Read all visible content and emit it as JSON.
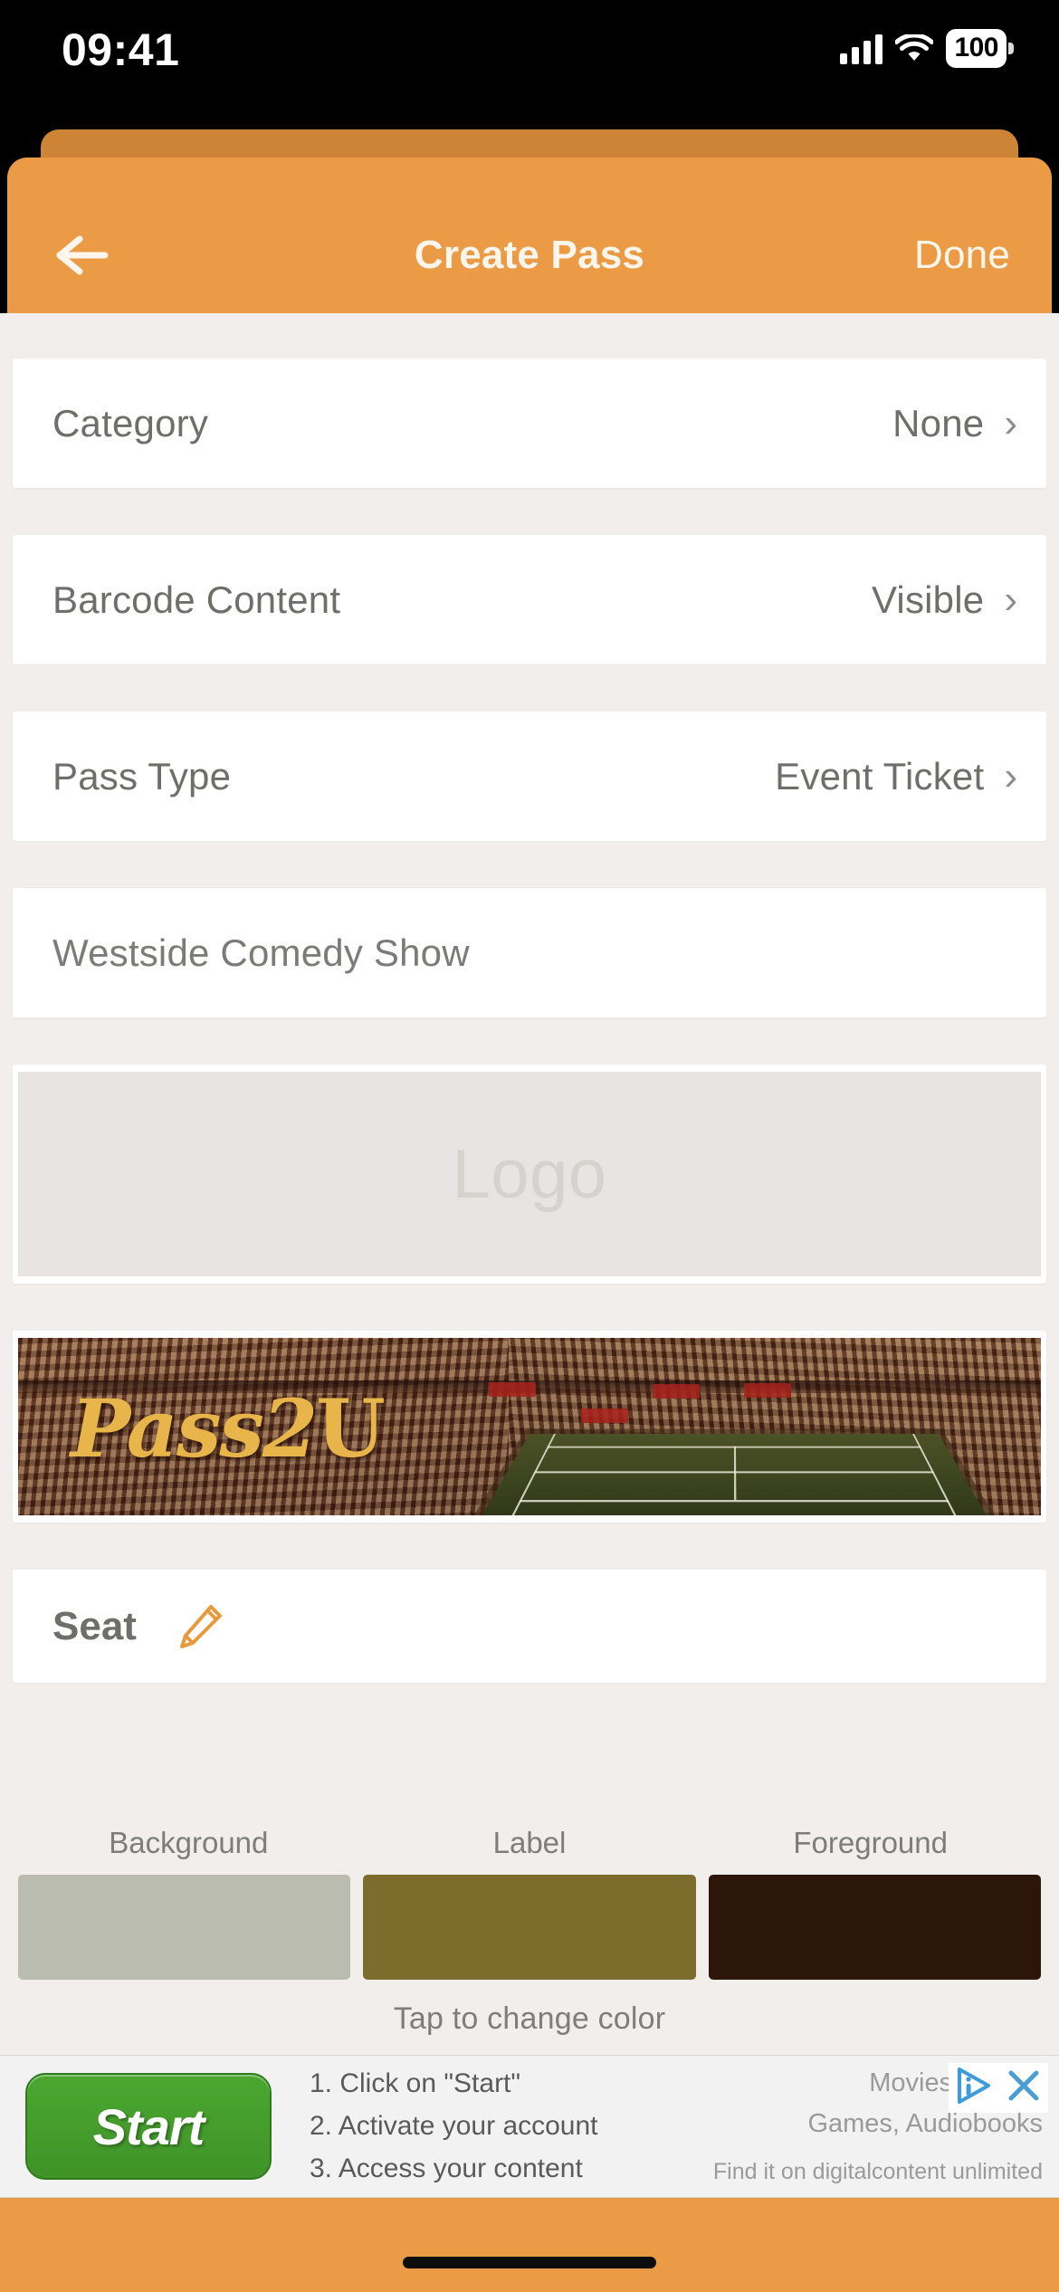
{
  "status_bar": {
    "time": "09:41",
    "battery_level": "100",
    "signal_icon": "cellular-bars-icon",
    "wifi_icon": "wifi-icon",
    "battery_icon": "battery-icon"
  },
  "nav": {
    "back_icon": "back-arrow-icon",
    "title": "Create Pass",
    "done_label": "Done"
  },
  "rows": [
    {
      "label": "Category",
      "value": "None",
      "chevron": "›"
    },
    {
      "label": "Barcode Content",
      "value": "Visible",
      "chevron": "›"
    },
    {
      "label": "Pass Type",
      "value": "Event Ticket",
      "chevron": "›"
    }
  ],
  "title_field": {
    "value": "Westside Comedy Show"
  },
  "logo": {
    "placeholder": "Logo"
  },
  "strip": {
    "brand_text": "Pass2",
    "brand_suffix": "U",
    "alt": "tennis-stadium-strip-image"
  },
  "seat": {
    "label": "Seat",
    "edit_icon": "pencil-edit-icon"
  },
  "colors": {
    "labels": [
      "Background",
      "Label",
      "Foreground"
    ],
    "values": [
      "#b9bcae",
      "#7d6d2d",
      "#2c1609"
    ],
    "hint": "Tap to change color"
  },
  "ad": {
    "button_label": "Start",
    "steps": [
      "1. Click on \"Start\"",
      "2. Activate your account",
      "3. Access your content"
    ],
    "right_line1": "Movies, Music,",
    "right_line2": "Games, Audiobooks",
    "right_line3": "Find it on digitalcontent unlimited",
    "adchoices_icon": "adchoices-icon",
    "close_icon": "close-x-icon"
  },
  "theme": {
    "accent": "#eb9b45",
    "accent_dark": "#ce8436",
    "page_bg": "#f1eeeb"
  }
}
